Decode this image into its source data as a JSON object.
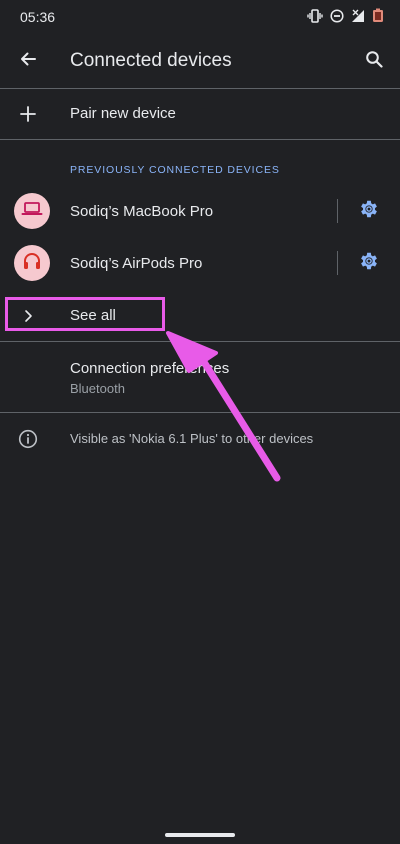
{
  "status_bar": {
    "time": "05:36",
    "icons": [
      "vibrate-icon",
      "do-not-disturb-icon",
      "no-signal-icon",
      "battery-saver-icon"
    ]
  },
  "app_bar": {
    "title": "Connected devices",
    "back_icon": "arrow-back-icon",
    "search_icon": "search-icon"
  },
  "pair_new": {
    "label": "Pair new device",
    "icon": "plus-icon"
  },
  "previously_connected": {
    "header": "PREVIOUSLY CONNECTED DEVICES",
    "devices": [
      {
        "name": "Sodiq’s MacBook Pro",
        "icon": "laptop-icon",
        "settings_icon": "gear-icon"
      },
      {
        "name": "Sodiq’s AirPods Pro",
        "icon": "headphones-icon",
        "settings_icon": "gear-icon"
      }
    ],
    "see_all": {
      "label": "See all",
      "icon": "chevron-right-icon"
    }
  },
  "connection_preferences": {
    "title": "Connection preferences",
    "subtitle": "Bluetooth"
  },
  "info": {
    "text": "Visible as 'Nokia 6.1 Plus' to other devices",
    "icon": "info-icon"
  },
  "colors": {
    "background": "#202124",
    "text_primary": "#e8eaed",
    "text_secondary": "#9aa0a6",
    "accent_blue": "#8ab4f8",
    "avatar_bg": "#f6c9cf",
    "device_icon_red": "#d93025",
    "device_icon_magenta": "#c2185b",
    "annotation_magenta": "#e85be8",
    "divider": "#5f6368"
  }
}
